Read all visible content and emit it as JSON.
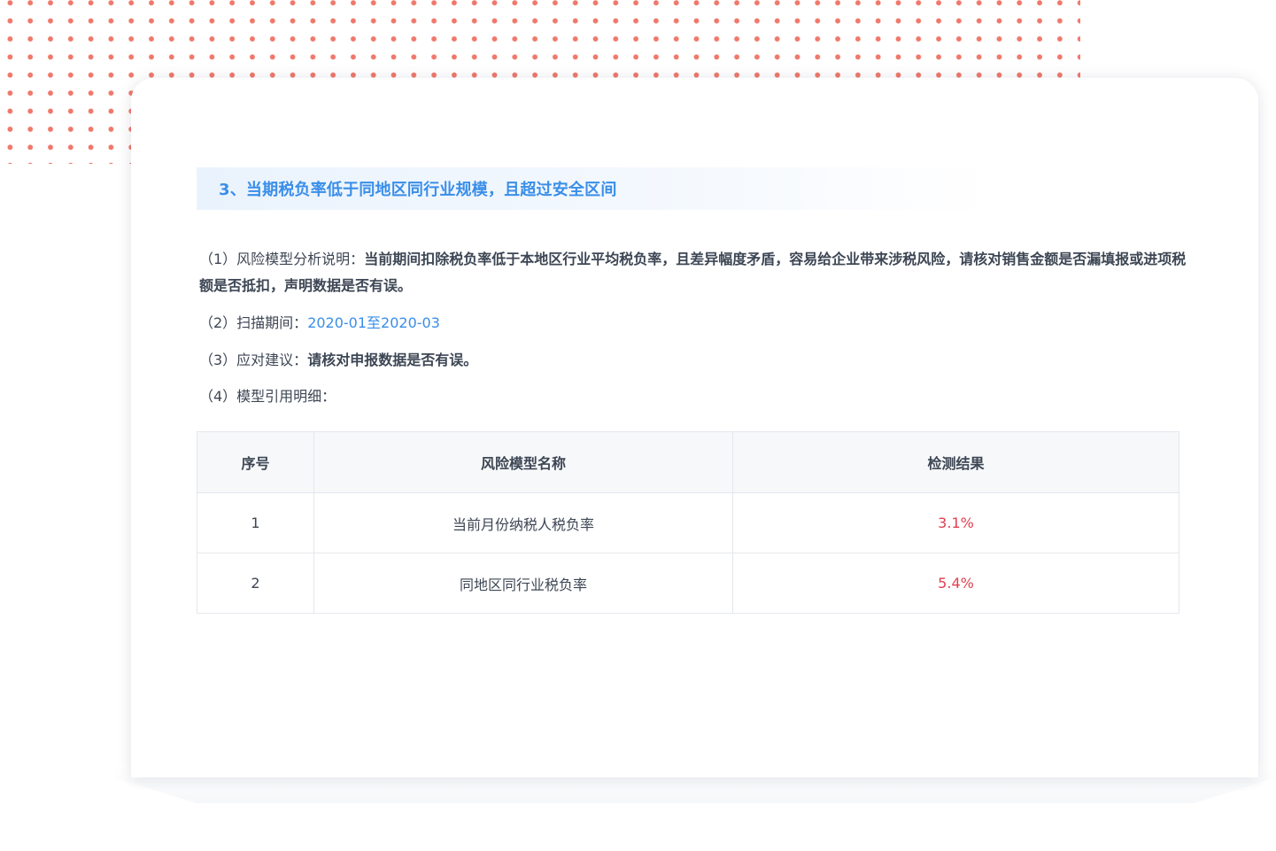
{
  "section": {
    "title": "3、当期税负率低于同地区同行业规模，且超过安全区间"
  },
  "details": {
    "item1_label": "（1）风险模型分析说明：",
    "item1_value": "当前期间扣除税负率低于本地区行业平均税负率，且差异幅度矛盾，容易给企业带来涉税风险，请核对销售金额是否漏填报或进项税额是否抵扣，声明数据是否有误。",
    "item2_label": "（2）扫描期间：",
    "item2_value": "2020-01至2020-03",
    "item3_label": "（3）应对建议：",
    "item3_value": "请核对申报数据是否有误。",
    "item4_label": "（4）模型引用明细："
  },
  "table": {
    "headers": [
      "序号",
      "风险模型名称",
      "检测结果"
    ],
    "rows": [
      {
        "index": "1",
        "name": "当前月份纳税人税负率",
        "result": "3.1%"
      },
      {
        "index": "2",
        "name": "同地区同行业税负率",
        "result": "5.4%"
      }
    ]
  },
  "colors": {
    "accent_blue": "#3a8ee8",
    "result_red": "#e04050",
    "dots": "#f0786a",
    "text": "#3d4654"
  }
}
